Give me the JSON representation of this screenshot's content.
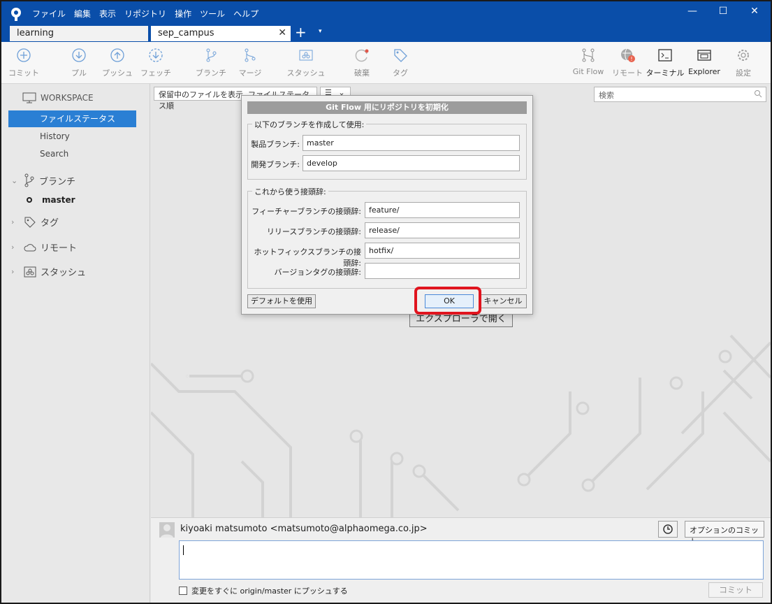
{
  "menu": [
    "ファイル",
    "編集",
    "表示",
    "リポジトリ",
    "操作",
    "ツール",
    "ヘルプ"
  ],
  "window_controls": {
    "minimize": "—",
    "maximize": "☐",
    "close": "✕"
  },
  "tabs": [
    {
      "label": "learning"
    },
    {
      "label": "sep_campus"
    }
  ],
  "tab_add": "+",
  "tab_dropdown": "▾",
  "tab_close": "✕",
  "toolbar": {
    "commit": "コミット",
    "pull": "プル",
    "push": "プッシュ",
    "fetch": "フェッチ",
    "branch": "ブランチ",
    "merge": "マージ",
    "stash": "スタッシュ",
    "discard": "破棄",
    "tag": "タグ",
    "gitflow": "Git Flow",
    "remote": "リモート",
    "terminal": "ターミナル",
    "explorer": "Explorer",
    "settings": "設定"
  },
  "sidebar": {
    "workspace": "WORKSPACE",
    "items": [
      {
        "label": "ファイルステータス",
        "active": true
      },
      {
        "label": "History"
      },
      {
        "label": "Search"
      }
    ],
    "branches": "ブランチ",
    "current_branch": "master",
    "tags": "タグ",
    "remotes": "リモート",
    "stashes": "スタッシュ"
  },
  "main": {
    "filter_label": "保留中のファイルを表示, ファイルステータス順",
    "list_mode": "☰",
    "search_placeholder": "検索",
    "explorer_button": "エクスプローラで開く"
  },
  "commit": {
    "author": "kiyoaki matsumoto <matsumoto@alphaomega.co.jp>",
    "options_button": "オプションのコミット",
    "push_checkbox_label": "変更をすぐに origin/master にプッシュする",
    "commit_button": "コミット"
  },
  "dialog": {
    "title": "Git Flow 用にリポジトリを初期化",
    "branches_group": "以下のブランチを作成して使用:",
    "production_label": "製品ブランチ:",
    "production_value": "master",
    "develop_label": "開発ブランチ:",
    "develop_value": "develop",
    "prefix_group": "これから使う接頭辞:",
    "feature_label": "フィーチャーブランチの接頭辞:",
    "feature_value": "feature/",
    "release_label": "リリースブランチの接頭辞:",
    "release_value": "release/",
    "hotfix_label": "ホットフィックスブランチの接頭辞:",
    "hotfix_value": "hotfix/",
    "version_label": "バージョンタグの接頭辞:",
    "version_value": "",
    "default_button": "デフォルトを使用",
    "ok_button": "OK",
    "cancel_button": "キャンセル"
  },
  "colors": {
    "titlebar": "#0a4ea9",
    "accent": "#2a7fd4",
    "highlight": "#e0141e"
  }
}
